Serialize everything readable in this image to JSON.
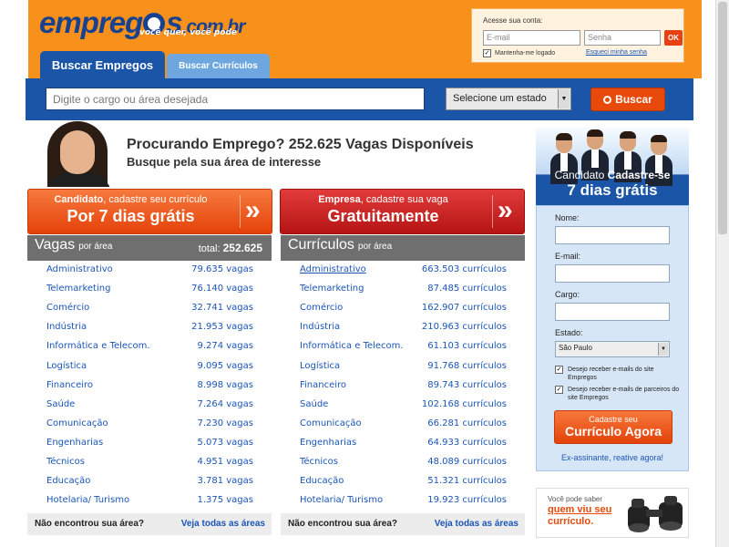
{
  "header": {
    "logo_main": "empregos",
    "logo_domain": ".com.br",
    "logo_tagline": "você quer, você pode"
  },
  "login": {
    "title": "Acesse sua conta:",
    "email_placeholder": "E-mail",
    "password_placeholder": "Senha",
    "ok_label": "OK",
    "keep_logged_label": "Mantenha-me logado",
    "forgot_label": "Esqueci minha senha"
  },
  "tabs": [
    {
      "label": "Buscar Empregos",
      "active": true
    },
    {
      "label": "Buscar Currículos",
      "active": false
    }
  ],
  "search": {
    "placeholder": "Digite o cargo ou área desejada",
    "state_select": "Selecione um estado",
    "button_label": "Buscar"
  },
  "hero": {
    "title": "Procurando Emprego? 252.625 Vagas Disponíveis",
    "subtitle": "Busque pela sua área de interesse"
  },
  "cta_candidate": {
    "line1_bold": "Candidato",
    "line1_rest": ", cadastre seu currículo",
    "line2": "Por 7 dias grátis",
    "chevron": "»"
  },
  "cta_company": {
    "line1_bold": "Empresa",
    "line1_rest": ", cadastre sua vaga",
    "line2": "Gratuitamente",
    "chevron": "»"
  },
  "jobs_panel": {
    "title": "Vagas",
    "subtitle": "por área",
    "total_label": "total:",
    "total_value": "252.625",
    "rows": [
      {
        "name": "Administrativo",
        "count": "79.635 vagas"
      },
      {
        "name": "Telemarketing",
        "count": "76.140 vagas"
      },
      {
        "name": "Comércio",
        "count": "32.741 vagas"
      },
      {
        "name": "Indústria",
        "count": "21.953 vagas"
      },
      {
        "name": "Informática e Telecom.",
        "count": "9.274 vagas"
      },
      {
        "name": "Logística",
        "count": "9.095 vagas"
      },
      {
        "name": "Financeiro",
        "count": "8.998 vagas"
      },
      {
        "name": "Saúde",
        "count": "7.264 vagas"
      },
      {
        "name": "Comunicação",
        "count": "7.230 vagas"
      },
      {
        "name": "Engenharias",
        "count": "5.073 vagas"
      },
      {
        "name": "Técnicos",
        "count": "4.951 vagas"
      },
      {
        "name": "Educação",
        "count": "3.781 vagas"
      },
      {
        "name": "Hotelaria/ Turismo",
        "count": "1.375 vagas"
      }
    ],
    "footer_question": "Não encontrou sua área?",
    "footer_link": "Veja todas as áreas"
  },
  "resumes_panel": {
    "title": "Currículos",
    "subtitle": "por área",
    "rows": [
      {
        "name": "Administrativo",
        "count": "663.503 currículos"
      },
      {
        "name": "Telemarketing",
        "count": "87.485 currículos"
      },
      {
        "name": "Comércio",
        "count": "162.907 currículos"
      },
      {
        "name": "Indústria",
        "count": "210.963 currículos"
      },
      {
        "name": "Informática e Telecom.",
        "count": "61.103 currículos"
      },
      {
        "name": "Logística",
        "count": "91.768 currículos"
      },
      {
        "name": "Financeiro",
        "count": "89.743 currículos"
      },
      {
        "name": "Saúde",
        "count": "102.168 currículos"
      },
      {
        "name": "Comunicação",
        "count": "66.281 currículos"
      },
      {
        "name": "Engenharias",
        "count": "64.933 currículos"
      },
      {
        "name": "Técnicos",
        "count": "48.089 currículos"
      },
      {
        "name": "Educação",
        "count": "51.321 currículos"
      },
      {
        "name": "Hotelaria/ Turismo",
        "count": "19.923 currículos"
      }
    ],
    "footer_question": "Não encontrou sua área?",
    "footer_link": "Veja todas as áreas"
  },
  "sidebar": {
    "banner_line1_normal": "Candidato",
    "banner_line1_bold": "Cadastre-se",
    "banner_line2": "7 dias grátis",
    "form": {
      "name_label": "Nome:",
      "email_label": "E-mail:",
      "role_label": "Cargo:",
      "state_label": "Estado:",
      "state_value": "São Paulo",
      "opt_in_1": "Desejo receber e-mails do site Empregos",
      "opt_in_2": "Desejo receber e-mails de parceiros do site Empregos",
      "submit_line1": "Cadastre seu",
      "submit_line2": "Currículo Agora",
      "reactivate": "Ex-assinante, reative agora!"
    },
    "ad": {
      "line1": "Você pode saber",
      "line2": "quem viu seu",
      "line3": "currículo."
    }
  },
  "colors": {
    "header_orange": "#f8901c",
    "brand_blue": "#1a55a8",
    "cta_orange": "#e4420a",
    "cta_red": "#b51414",
    "link_blue": "#1a55b8"
  }
}
